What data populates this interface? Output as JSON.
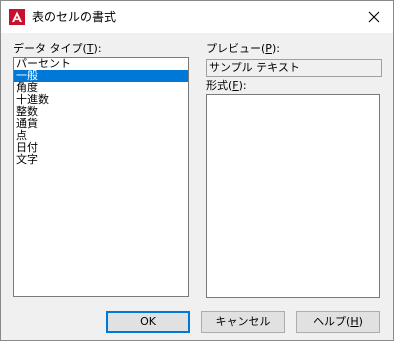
{
  "window": {
    "title": "表のセルの書式",
    "icon": "autocad-a-icon",
    "accent_color": "#0078d7"
  },
  "data_type": {
    "label_prefix": "データ タイプ(",
    "label_key": "T",
    "label_suffix": "):",
    "items": [
      "パーセント",
      "一般",
      "角度",
      "十進数",
      "整数",
      "通貨",
      "点",
      "日付",
      "文字"
    ],
    "selected": "一般"
  },
  "preview": {
    "label_prefix": "プレビュー(",
    "label_key": "P",
    "label_suffix": "):",
    "value": "サンプル テキスト"
  },
  "format": {
    "label_prefix": "形式(",
    "label_key": "F",
    "label_suffix": "):"
  },
  "buttons": {
    "ok": "OK",
    "cancel": "キャンセル",
    "help_prefix": "ヘルプ(",
    "help_key": "H",
    "help_suffix": ")"
  }
}
